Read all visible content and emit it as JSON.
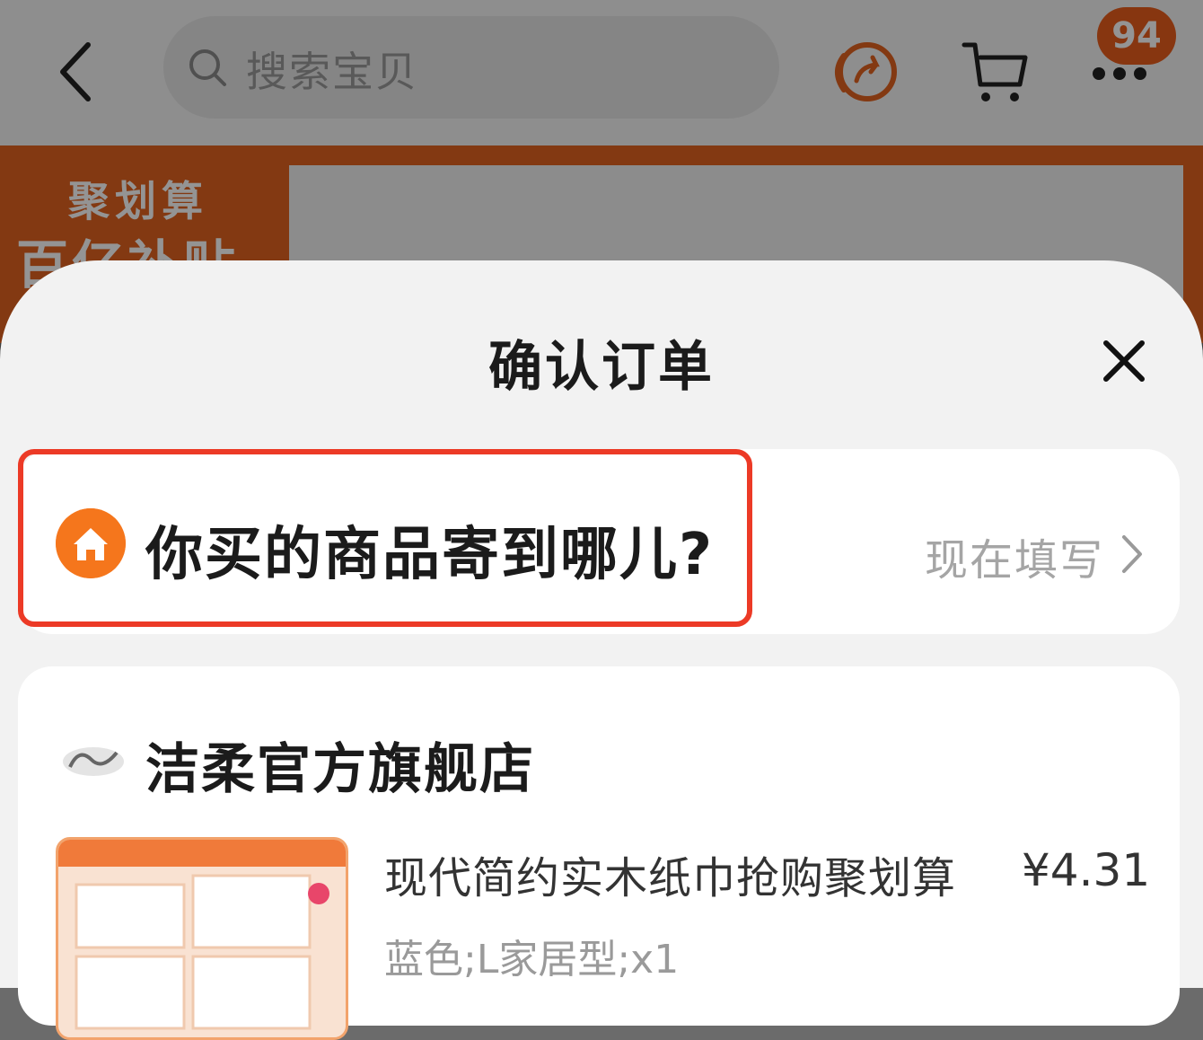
{
  "app": {
    "search_placeholder": "搜索宝贝",
    "message_count": "94",
    "banner_line1": "聚划算",
    "banner_line2": "百亿补贴"
  },
  "sheet": {
    "title": "确认订单",
    "address": {
      "prompt": "你买的商品寄到哪儿?",
      "action": "现在填写"
    },
    "store": {
      "name": "洁柔官方旗舰店",
      "item": {
        "title": "现代简约实木纸巾抢购聚划算",
        "price": "¥4.31",
        "spec": "蓝色;L家居型;x1"
      }
    }
  },
  "colors": {
    "accent": "#e2621f",
    "highlight": "#ec3a26",
    "home_icon": "#f5761c"
  },
  "icons": [
    "back-icon",
    "search-icon",
    "share-icon",
    "cart-icon",
    "more-icon",
    "close-icon",
    "home-icon",
    "chevron-right-icon",
    "store-logo"
  ]
}
